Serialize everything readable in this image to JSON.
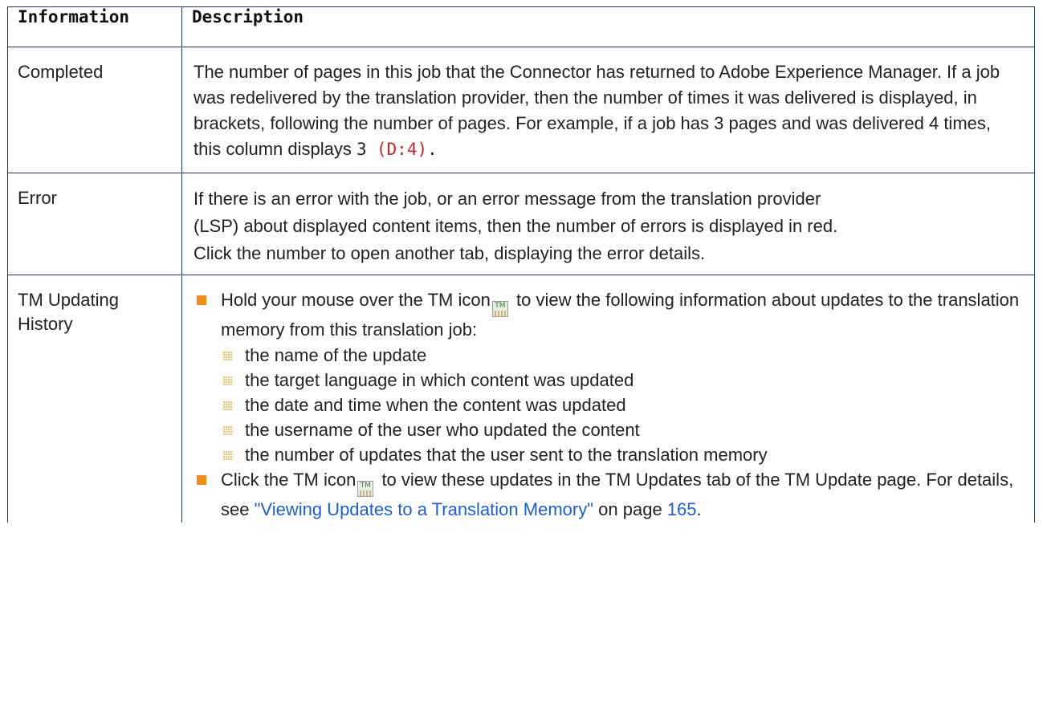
{
  "table": {
    "headers": [
      "Information",
      "Description"
    ],
    "rows": [
      {
        "label": "Completed",
        "text_before_code": "The number of pages in this job that the Connector has returned to Adobe Experience Manager. If a job was redelivered by the translation provider, then the number of times it was delivered is displayed, in brackets, following the number of pages. For example, if a job has 3 pages and was delivered 4 times, this column displays",
        "code_number": "3",
        "code_red": "(D:4)",
        "text_after_code": "."
      },
      {
        "label": "Error",
        "lines": [
          "If there is an error with the job, or an error message from the translation provider",
          "(LSP) about displayed content items, then the number of errors is displayed in red.",
          "Click the number to open another tab, displaying the error details."
        ]
      },
      {
        "label_line1": "TM Updating",
        "label_line2": "History",
        "bullet1": {
          "before_icon": "Hold your mouse over the TM icon",
          "after_icon": "to view the following information about updates to the translation memory from this translation job:",
          "icon": "tm-icon",
          "sub_items": [
            "the name of the update",
            "the target language in which content was updated",
            "the date and time when the content was updated",
            "the username of the user who updated the content",
            "the number of updates that the user sent to the translation memory"
          ]
        },
        "bullet2": {
          "before_icon": "Click the TM icon",
          "after_icon": "to view these updates in the TM Updates tab of the TM Update page. For details, see",
          "link_text": "\"Viewing Updates to a Translation Memory\"",
          "on_page": "on page",
          "page_number": "165",
          "end": ".",
          "icon": "tm-icon"
        }
      }
    ]
  },
  "colors": {
    "border": "#1f3a5f",
    "bullet_square": "#f28c1e",
    "link": "#1a5fd6",
    "code_red": "#c0282d"
  }
}
